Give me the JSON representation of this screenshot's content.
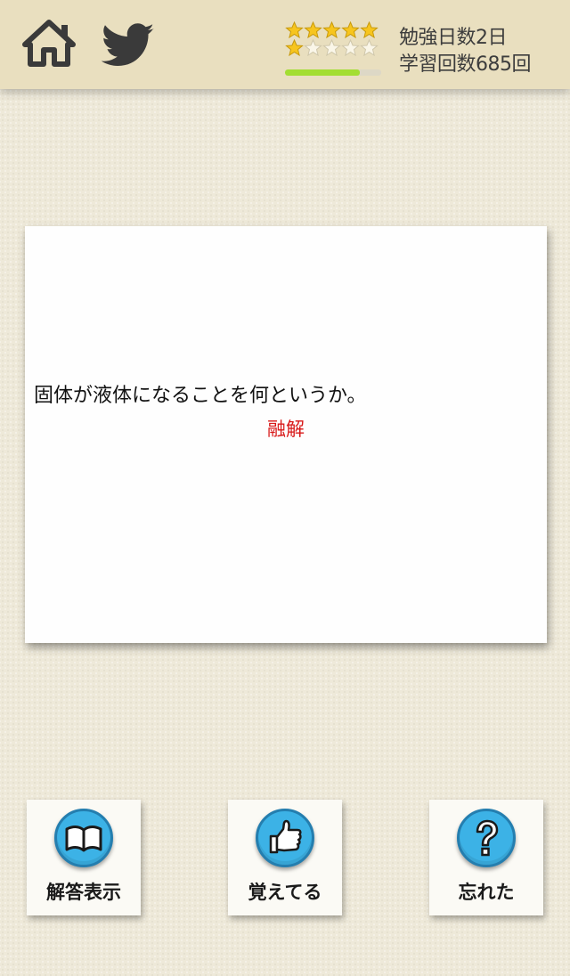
{
  "header": {
    "rating": {
      "row1_filled": 5,
      "row1_total": 5,
      "row2_filled": 1,
      "row2_total": 5
    },
    "progress_fraction": 0.78,
    "study_days": "勉強日数2日",
    "study_count": "学習回数685回"
  },
  "card": {
    "question": "固体が液体になることを何というか。",
    "answer": "融解"
  },
  "actions": {
    "show_answer": "解答表示",
    "remember": "覚えてる",
    "forgot": "忘れた"
  },
  "colors": {
    "header_bg": "#e9dfbf",
    "page_bg": "#eee9d9",
    "star_gold": "#f7c51e",
    "progress": "#a3de32",
    "answer_red": "#d81818",
    "button_blue": "#3cb2e6"
  },
  "icons": [
    "home-icon",
    "twitter-icon",
    "star-icon",
    "book-icon",
    "thumbs-up-icon",
    "question-mark-icon"
  ]
}
